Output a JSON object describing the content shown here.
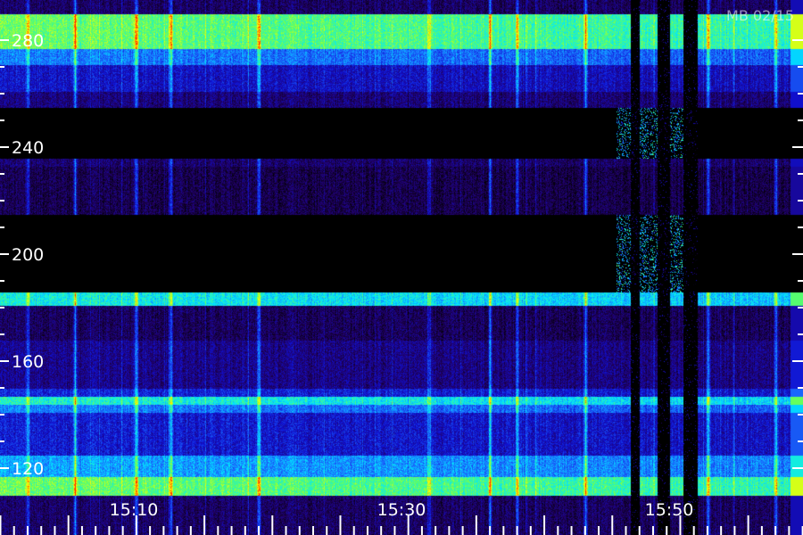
{
  "station_label": "MB 02/15",
  "chart_data": {
    "type": "heatmap",
    "title": "",
    "xlabel": "",
    "ylabel": "",
    "x_ticks": [
      {
        "value": 1510,
        "label": "15:10"
      },
      {
        "value": 1530,
        "label": "15:30"
      },
      {
        "value": 1550,
        "label": "15:50"
      }
    ],
    "y_ticks": [
      {
        "value": 280,
        "label": "280"
      },
      {
        "value": 240,
        "label": "240"
      },
      {
        "value": 200,
        "label": "200"
      },
      {
        "value": 160,
        "label": "160"
      },
      {
        "value": 120,
        "label": "120"
      }
    ],
    "x_range_minutes": [
      0,
      59
    ],
    "ylim": [
      110,
      290
    ],
    "grid": false,
    "colormap": [
      "#000000",
      "#200060",
      "#1010d0",
      "#1a6cff",
      "#00e8ff",
      "#60ff60",
      "#ffff00",
      "#ff2000"
    ],
    "bands": [
      {
        "from": 277,
        "to": 290,
        "level": 0.72
      },
      {
        "from": 271,
        "to": 277,
        "level": 0.45
      },
      {
        "from": 261,
        "to": 271,
        "level": 0.28
      },
      {
        "from": 255,
        "to": 261,
        "level": 0.18
      },
      {
        "from": 236,
        "to": 255,
        "level": 0.0
      },
      {
        "from": 233,
        "to": 236,
        "level": 0.16
      },
      {
        "from": 215,
        "to": 233,
        "level": 0.12
      },
      {
        "from": 205,
        "to": 215,
        "level": 0.0
      },
      {
        "from": 190,
        "to": 205,
        "level": 0.0
      },
      {
        "from": 186,
        "to": 190,
        "level": 0.0
      },
      {
        "from": 181,
        "to": 186,
        "level": 0.6
      },
      {
        "from": 168,
        "to": 181,
        "level": 0.14
      },
      {
        "from": 150,
        "to": 168,
        "level": 0.2
      },
      {
        "from": 147,
        "to": 150,
        "level": 0.32
      },
      {
        "from": 144,
        "to": 147,
        "level": 0.62
      },
      {
        "from": 141,
        "to": 144,
        "level": 0.45
      },
      {
        "from": 125,
        "to": 141,
        "level": 0.3
      },
      {
        "from": 117,
        "to": 125,
        "level": 0.5
      },
      {
        "from": 110,
        "to": 117,
        "level": 0.72
      }
    ],
    "events_minutes": [
      2,
      5.5,
      10,
      12.5,
      19,
      31.5,
      36,
      38,
      43,
      52,
      57
    ],
    "data_gaps_minutes": [
      [
        46.3,
        47.0
      ],
      [
        48.3,
        49.2
      ],
      [
        50.2,
        51.2
      ]
    ]
  }
}
